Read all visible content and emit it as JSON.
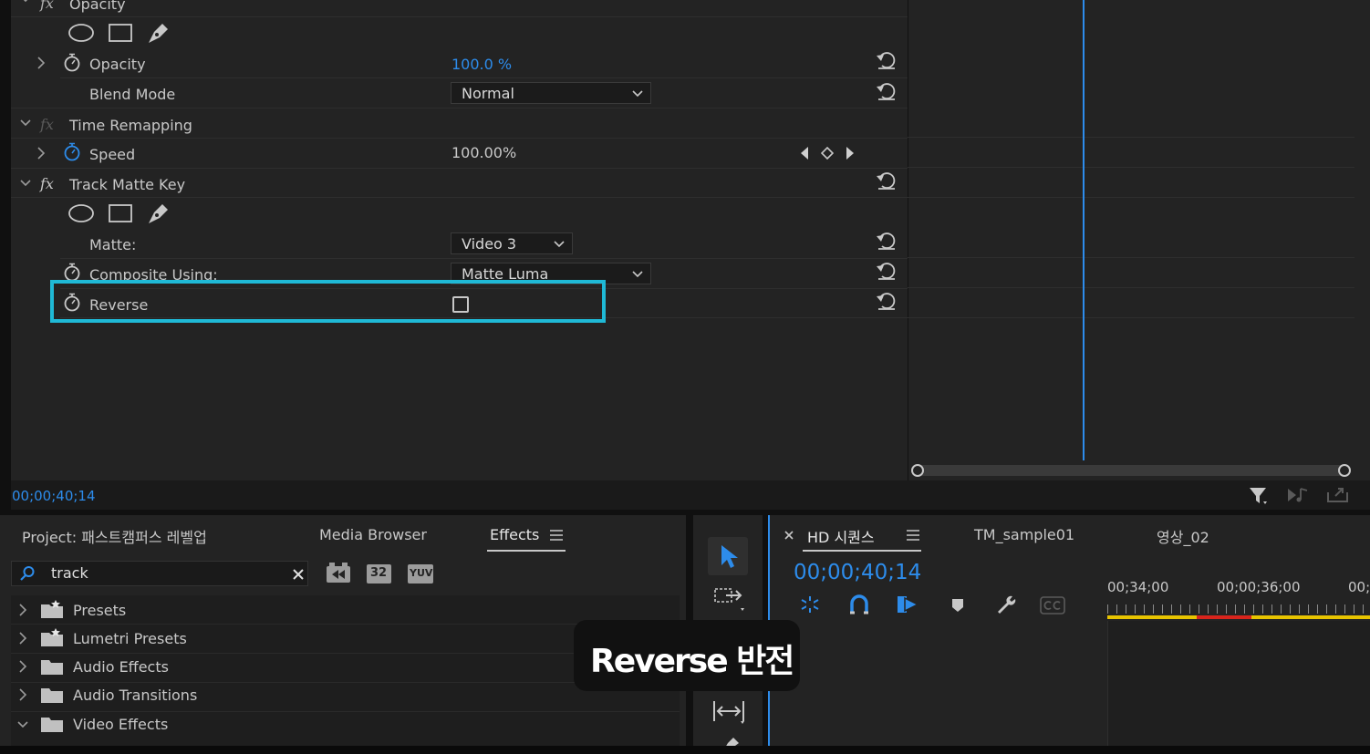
{
  "effect_controls": {
    "opacity_section": "Opacity",
    "opacity_label": "Opacity",
    "opacity_value": "100.0 %",
    "blend_mode_label": "Blend Mode",
    "blend_mode_value": "Normal",
    "time_remapping_section": "Time Remapping",
    "speed_label": "Speed",
    "speed_value": "100.00%",
    "track_matte_section": "Track Matte Key",
    "matte_label": "Matte:",
    "matte_value": "Video 3",
    "composite_label": "Composite Using:",
    "composite_value": "Matte Luma",
    "reverse_label": "Reverse",
    "timecode": "00;00;40;14"
  },
  "project_panel": {
    "tabs": [
      "Project: 패스트캠퍼스 레벨업",
      "Media Browser",
      "Effects"
    ],
    "search_value": "track",
    "badge_32": "32",
    "badge_yuv": "YUV",
    "tree": [
      "Presets",
      "Lumetri Presets",
      "Audio Effects",
      "Audio Transitions",
      "Video Effects"
    ]
  },
  "timeline": {
    "tabs": [
      "HD 시퀀스",
      "TM_sample01",
      "영상_02"
    ],
    "timecode": "00;00;40;14",
    "ruler": [
      "00;34;00",
      "00;00;36;00",
      "00;"
    ]
  },
  "caption": "Reverse 반전",
  "colors": {
    "accent_blue": "#2d8ceb",
    "highlight_cyan": "#1fb9d6",
    "ruler_yellow": "#e8c400",
    "ruler_red": "#d8241c"
  }
}
